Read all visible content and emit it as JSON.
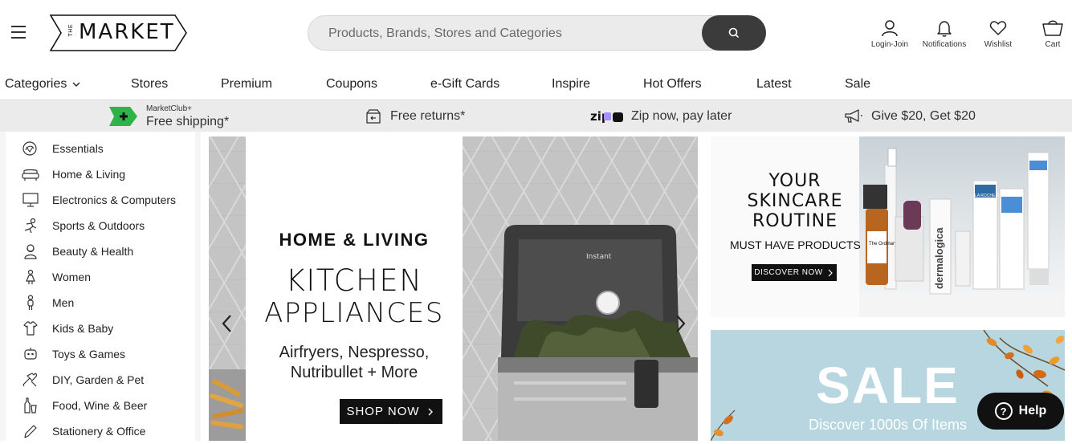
{
  "header": {
    "logo_text": "MARKET",
    "logo_small": "THE",
    "search_placeholder": "Products, Brands, Stores and Categories",
    "icons": [
      {
        "label": "Login-Join",
        "icon": "user-icon"
      },
      {
        "label": "Notifications",
        "icon": "bell-icon"
      },
      {
        "label": "Wishlist",
        "icon": "heart-icon"
      },
      {
        "label": "Cart",
        "icon": "cart-icon"
      }
    ]
  },
  "nav": {
    "items": [
      "Categories",
      "Stores",
      "Premium",
      "Coupons",
      "e-Gift Cards",
      "Inspire",
      "Hot Offers",
      "Latest",
      "Sale"
    ]
  },
  "promo": {
    "club_small": "MarketClub+",
    "club_main": "Free shipping*",
    "returns": "Free returns*",
    "zip": "Zip now, pay later",
    "zip_logo": "zip",
    "referral": "Give $20, Get $20"
  },
  "sidebar": {
    "items": [
      {
        "label": "Essentials",
        "icon": "essentials-icon"
      },
      {
        "label": "Home & Living",
        "icon": "sofa-icon"
      },
      {
        "label": "Electronics & Computers",
        "icon": "monitor-icon"
      },
      {
        "label": "Sports & Outdoors",
        "icon": "sports-icon"
      },
      {
        "label": "Beauty & Health",
        "icon": "beauty-icon"
      },
      {
        "label": "Women",
        "icon": "woman-icon"
      },
      {
        "label": "Men",
        "icon": "man-icon"
      },
      {
        "label": "Kids & Baby",
        "icon": "kids-icon"
      },
      {
        "label": "Toys & Games",
        "icon": "toy-icon"
      },
      {
        "label": "DIY, Garden & Pet",
        "icon": "tools-icon"
      },
      {
        "label": "Food, Wine & Beer",
        "icon": "bottle-icon"
      },
      {
        "label": "Stationery & Office",
        "icon": "pencil-icon"
      }
    ]
  },
  "hero": {
    "kicker": "HOME & LIVING",
    "title_line1": "KITCHEN",
    "title_line2": "APPLIANCES",
    "sub_line1": "Airfryers, Nespresso,",
    "sub_line2": "Nutribullet + More",
    "cta": "SHOP NOW",
    "product_brand": "Instant"
  },
  "banner_skincare": {
    "head1": "YOUR",
    "head2": "SKINCARE",
    "head3": "ROUTINE",
    "sub": "MUST HAVE PRODUCTS",
    "cta": "DISCOVER NOW",
    "product_labels": [
      "The Ordinary.",
      "dermalogica",
      "LA ROCHE-POSAY"
    ]
  },
  "banner_sale": {
    "title": "SALE",
    "sub": "Discover 1000s Of Items"
  },
  "help": {
    "label": "Help"
  }
}
